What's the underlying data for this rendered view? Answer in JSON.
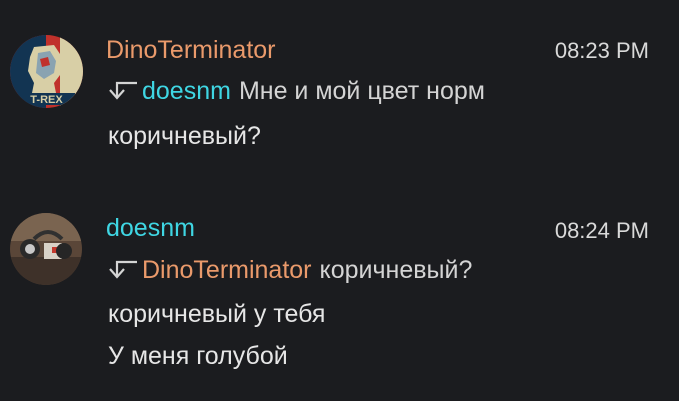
{
  "messages": [
    {
      "author": "DinoTerminator",
      "author_color": "#ea9a6b",
      "avatar_icon": "trex-poster-avatar",
      "avatar_badge": "T-REX",
      "time": "08:23 PM",
      "reply_to": {
        "author": "doesnm",
        "author_color": "#3fd6e3",
        "text": "Мне и мой цвет норм"
      },
      "lines": [
        "коричневый?"
      ]
    },
    {
      "author": "doesnm",
      "author_color": "#3fd6e3",
      "avatar_icon": "headphones-photo-avatar",
      "time": "08:24 PM",
      "reply_to": {
        "author": "DinoTerminator",
        "author_color": "#ea9a6b",
        "text": "коричневый?"
      },
      "lines": [
        "коричневый у тебя",
        "У меня голубой"
      ]
    }
  ]
}
